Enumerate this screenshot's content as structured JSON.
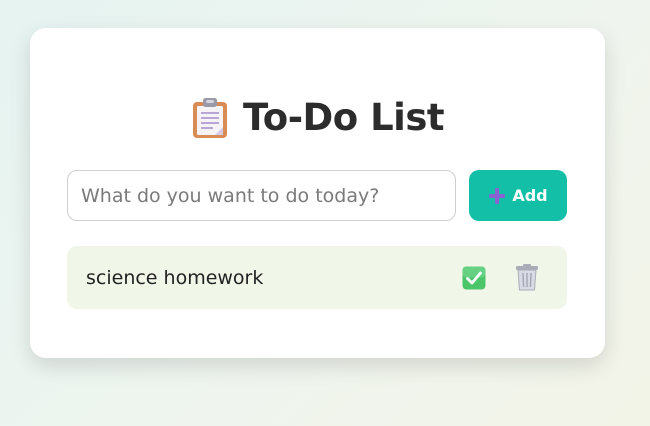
{
  "app": {
    "title": "To-Do List",
    "title_icon": "clipboard-icon"
  },
  "input": {
    "value": "",
    "placeholder": "What do you want to do today?"
  },
  "add_button": {
    "label": "Add",
    "icon": "plus-icon"
  },
  "tasks": [
    {
      "text": "science homework",
      "done_icon": "check-icon",
      "delete_icon": "trash-icon"
    }
  ],
  "colors": {
    "accent": "#13bfa6",
    "task_background": "#f0f6e8",
    "check": "#4cc46a",
    "plus": "#8a62d4"
  }
}
